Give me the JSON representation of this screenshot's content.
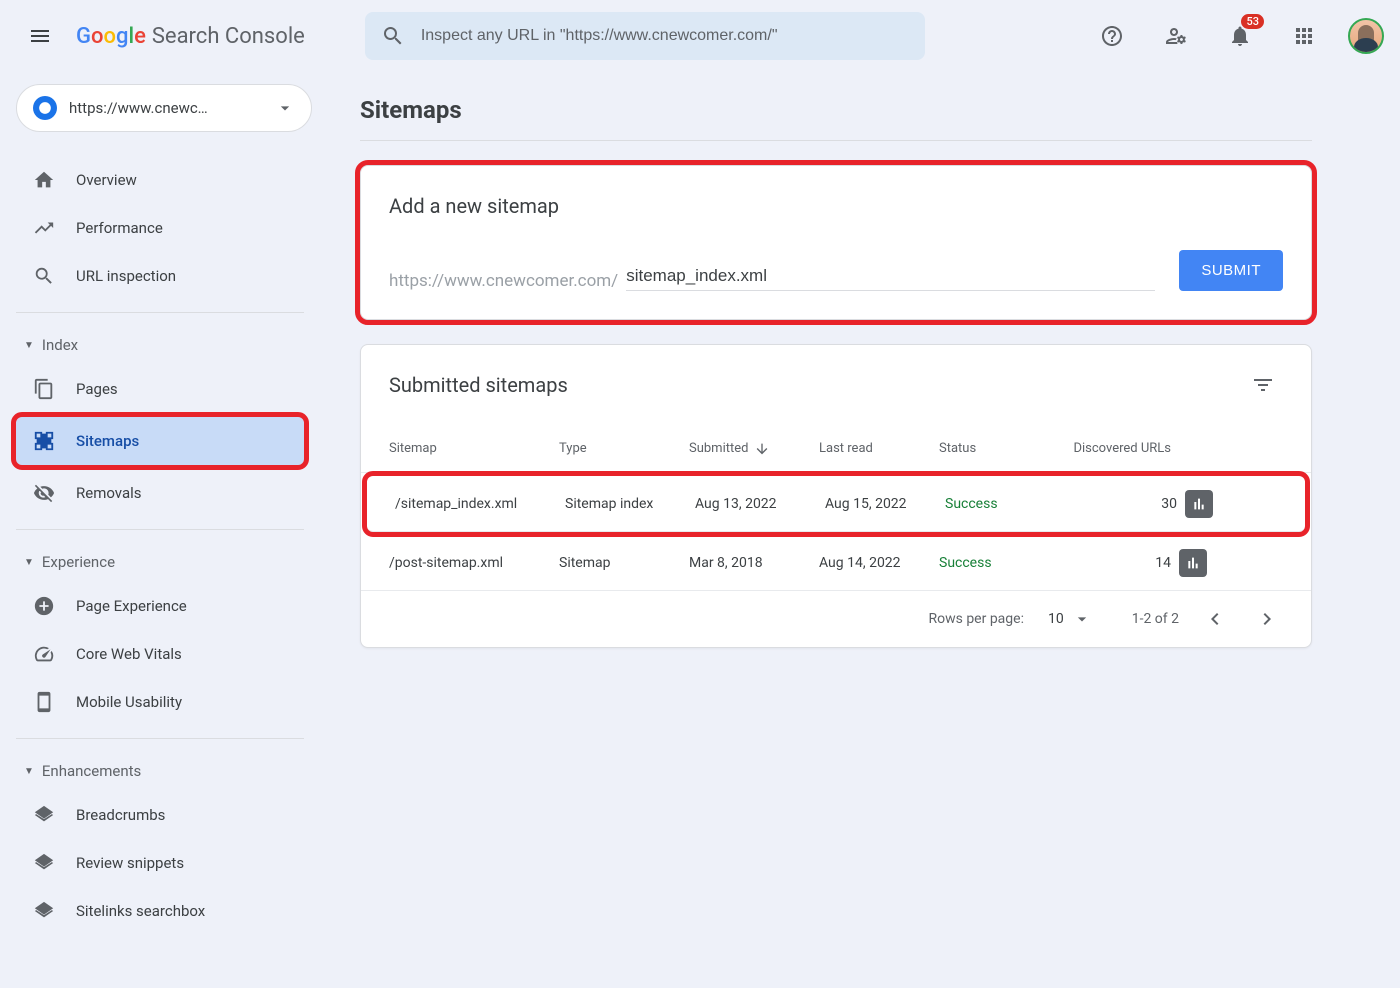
{
  "header": {
    "logo_text": "Search Console",
    "search_placeholder": "Inspect any URL in \"https://www.cnewcomer.com/\"",
    "notification_count": "53"
  },
  "property": {
    "url": "https://www.cnewc…"
  },
  "sidebar": {
    "overview": "Overview",
    "performance": "Performance",
    "url_inspection": "URL inspection",
    "section_index": "Index",
    "pages": "Pages",
    "sitemaps": "Sitemaps",
    "removals": "Removals",
    "section_experience": "Experience",
    "page_experience": "Page Experience",
    "core_web_vitals": "Core Web Vitals",
    "mobile_usability": "Mobile Usability",
    "section_enhancements": "Enhancements",
    "breadcrumbs": "Breadcrumbs",
    "review_snippets": "Review snippets",
    "sitelinks_searchbox": "Sitelinks searchbox"
  },
  "page": {
    "title": "Sitemaps",
    "add_card": {
      "title": "Add a new sitemap",
      "url_prefix": "https://www.cnewcomer.com/",
      "input_value": "sitemap_index.xml",
      "submit": "SUBMIT"
    },
    "list_card": {
      "title": "Submitted sitemaps",
      "columns": {
        "sitemap": "Sitemap",
        "type": "Type",
        "submitted": "Submitted",
        "last_read": "Last read",
        "status": "Status",
        "discovered": "Discovered URLs"
      },
      "rows": [
        {
          "sitemap": "/sitemap_index.xml",
          "type": "Sitemap index",
          "submitted": "Aug 13, 2022",
          "last_read": "Aug 15, 2022",
          "status": "Success",
          "urls": "30"
        },
        {
          "sitemap": "/post-sitemap.xml",
          "type": "Sitemap",
          "submitted": "Mar 8, 2018",
          "last_read": "Aug 14, 2022",
          "status": "Success",
          "urls": "14"
        }
      ],
      "pagination": {
        "rows_label": "Rows per page:",
        "rows_value": "10",
        "range": "1-2 of 2"
      }
    }
  }
}
